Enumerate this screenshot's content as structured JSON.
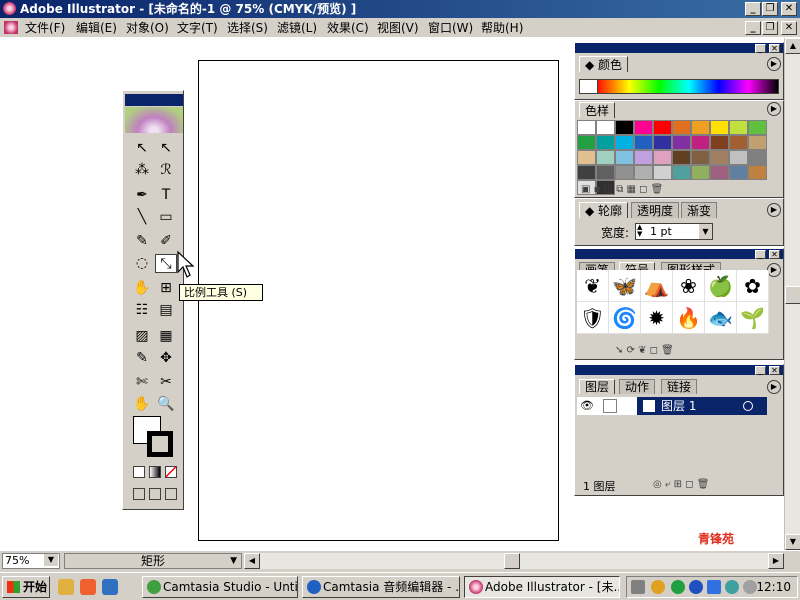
{
  "window": {
    "title": "Adobe Illustrator - [未命名的-1 @ 75% (CMYK/预览) ]",
    "min": "_",
    "restore": "❐",
    "close": "✕"
  },
  "menu": {
    "items": [
      "文件(F)",
      "编辑(E)",
      "对象(O)",
      "文字(T)",
      "选择(S)",
      "滤镜(L)",
      "效果(C)",
      "视图(V)",
      "窗口(W)",
      "帮助(H)"
    ]
  },
  "tooltip": "比例工具 (S)",
  "toolbox": {
    "tools": [
      "↖",
      "↖",
      "⁂",
      "ℛ",
      "✒",
      "T",
      "╲",
      "▭",
      "✎",
      "✐",
      "◌",
      "⤡",
      "✋",
      "⊞",
      "☷",
      "▤",
      "▨",
      "▦",
      "✎",
      "✥",
      "✄",
      "✂",
      "✋",
      "🔍"
    ],
    "selected_tool": "scale-tool"
  },
  "panels": {
    "color": {
      "tab": "颜色"
    },
    "swatches": {
      "tab": "色样"
    },
    "stroke": {
      "tabs": [
        "轮廓",
        "透明度",
        "渐变"
      ],
      "width_label": "宽度:",
      "width_value": "1 pt"
    },
    "symbols": {
      "tabs": [
        "画笔",
        "符号",
        "图形样式"
      ]
    },
    "layers": {
      "tabs": [
        "图层",
        "动作",
        "链接"
      ],
      "layer_name": "图层  1",
      "footer": "1 图层"
    }
  },
  "swatch_colors": [
    "#ffffff",
    "#ffffff",
    "#000000",
    "#ff0090",
    "#ff0000",
    "#e07020",
    "#f0a020",
    "#ffe000",
    "#c0e040",
    "#60c040",
    "#20a040",
    "#00a0a0",
    "#00b0e0",
    "#2060c0",
    "#3030a0",
    "#8030a0",
    "#c02080",
    "#804020",
    "#a06030",
    "#c0a070",
    "#e0c090",
    "#a0d0c0",
    "#80c0e0",
    "#c0a0e0",
    "#e0a0c0",
    "#604020",
    "#806040",
    "#a08060",
    "#c0c0c0",
    "#808080",
    "#404040",
    "#606060",
    "#909090",
    "#b0b0b0",
    "#d0d0d0",
    "#50a0a0",
    "#90b060",
    "#a06080",
    "#6080a0",
    "#c08040",
    "#e0e0e0",
    "#303030"
  ],
  "symbols": [
    "❦",
    "🦋",
    "⛺",
    "❀",
    "🍏",
    "✿",
    "🛡",
    "🌀",
    "✹",
    "🔥",
    "🐟",
    "🌱"
  ],
  "status": {
    "zoom": "75%",
    "field": "矩形"
  },
  "taskbar": {
    "start": "开始",
    "tasks": [
      "Camtasia Studio - Untitl...",
      "Camtasia 音频编辑器 - ...",
      "Adobe Illustrator - [未..."
    ],
    "clock": "12:10"
  },
  "watermark": "青锋苑",
  "colors": {
    "titlebar": "#0a246a",
    "face": "#d4d0c8",
    "tooltip": "#ffffe1"
  }
}
